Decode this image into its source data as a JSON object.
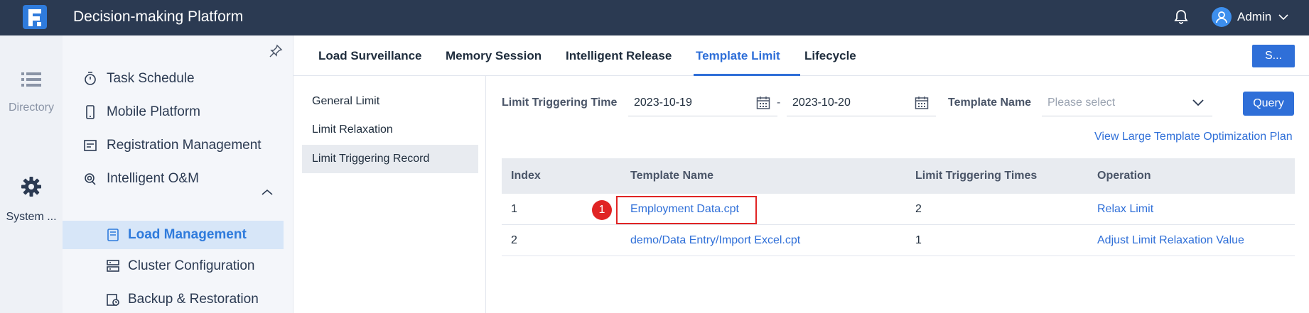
{
  "app": {
    "title": "Decision-making Platform"
  },
  "user": {
    "name": "Admin"
  },
  "rail": [
    {
      "label": "Directory",
      "icon": "list-icon"
    },
    {
      "label": "System ...",
      "icon": "gear-icon"
    }
  ],
  "menu": {
    "items": [
      {
        "label": "Task Schedule",
        "icon": "timer-icon"
      },
      {
        "label": "Mobile Platform",
        "icon": "mobile-icon"
      },
      {
        "label": "Registration Management",
        "icon": "registration-icon"
      },
      {
        "label": "Intelligent O&M",
        "icon": "om-icon"
      }
    ],
    "sub_items": [
      {
        "label": "Load Management",
        "icon": "load-icon",
        "active": true
      },
      {
        "label": "Cluster Configuration",
        "icon": "cluster-icon"
      },
      {
        "label": "Backup & Restoration",
        "icon": "backup-icon"
      }
    ]
  },
  "tabs": [
    {
      "label": "Load Surveillance"
    },
    {
      "label": "Memory Session"
    },
    {
      "label": "Intelligent Release"
    },
    {
      "label": "Template Limit",
      "active": true
    },
    {
      "label": "Lifecycle"
    }
  ],
  "top_right_button": "S...",
  "submenu": [
    {
      "label": "General Limit"
    },
    {
      "label": "Limit Relaxation"
    },
    {
      "label": "Limit Triggering Record",
      "active": true
    }
  ],
  "filter": {
    "time_label": "Limit Triggering Time",
    "start_date": "2023-10-19",
    "separator": "-",
    "end_date": "2023-10-20",
    "template_label": "Template Name",
    "template_placeholder": "Please select",
    "query_label": "Query"
  },
  "plan_link": "View Large Template Optimization Plan",
  "table": {
    "headers": [
      "Index",
      "Template Name",
      "Limit Triggering Times",
      "Operation"
    ],
    "rows": [
      {
        "index": "1",
        "template": "Employment Data.cpt",
        "times": "2",
        "operation": "Relax Limit"
      },
      {
        "index": "2",
        "template": "demo/Data Entry/Import Excel.cpt",
        "times": "1",
        "operation": "Adjust Limit Relaxation Value"
      }
    ]
  },
  "annotation": {
    "badge": "1"
  },
  "colors": {
    "topbar": "#2b3a52",
    "accent": "#2f6fd8",
    "highlight": "#e02424",
    "active_menu_bg": "#d7e6f8"
  }
}
